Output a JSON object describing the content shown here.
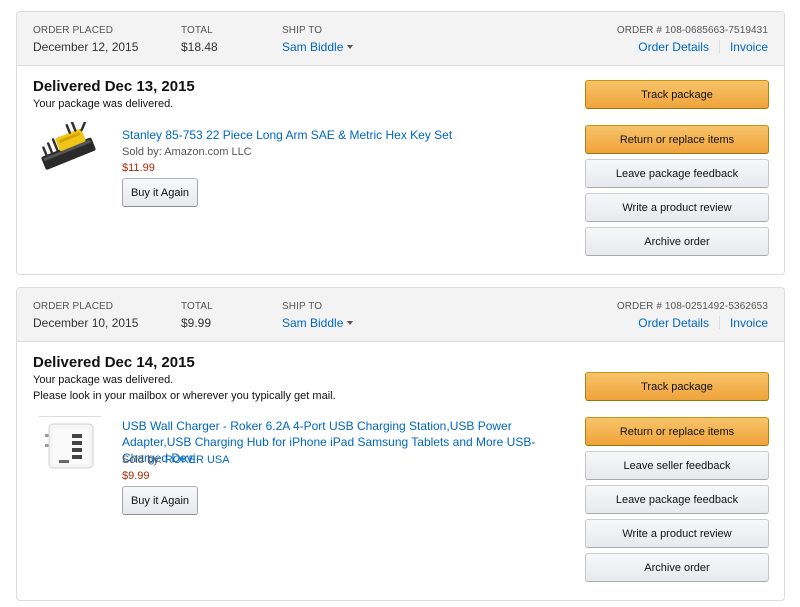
{
  "orders": [
    {
      "placed_label": "ORDER PLACED",
      "placed_date": "December 12, 2015",
      "total_label": "TOTAL",
      "total": "$18.48",
      "ship_label": "SHIP TO",
      "ship_to": "Sam Biddle",
      "order_number": "ORDER # 108-0685663-7519431",
      "details_link": "Order Details",
      "invoice_link": "Invoice",
      "status_title": "Delivered Dec 13, 2015",
      "status_line1": "Your package was delivered.",
      "item_title": "Stanley 85-753 22 Piece Long Arm SAE & Metric Hex Key Set",
      "sold_by_prefix": "Sold by:",
      "seller": "Amazon.com LLC",
      "price": "$11.99",
      "buy_again": "Buy it Again",
      "actions": [
        "Track package",
        "Return or replace items",
        "Leave package feedback",
        "Write a product review",
        "Archive order"
      ]
    },
    {
      "placed_label": "ORDER PLACED",
      "placed_date": "December 10, 2015",
      "total_label": "TOTAL",
      "total": "$9.99",
      "ship_label": "SHIP TO",
      "ship_to": "Sam Biddle",
      "order_number": "ORDER # 108-0251492-5362653",
      "details_link": "Order Details",
      "invoice_link": "Invoice",
      "status_title": "Delivered Dec 14, 2015",
      "status_line1": "Your package was delivered.",
      "status_line2": "Please look in your mailbox or wherever you typically get mail.",
      "item_title": "USB Wall Charger - Roker 6.2A 4-Port USB Charging Station,USB Power Adapter,USB Charging Hub for iPhone iPad Samsung Tablets and More USB-Charged Devi",
      "sold_by_prefix": "Sold by:",
      "seller": "ROKER USA",
      "price": "$9.99",
      "buy_again": "Buy it Again",
      "actions": [
        "Track package",
        "Return or replace items",
        "Leave seller feedback",
        "Leave package feedback",
        "Write a product review",
        "Archive order"
      ]
    }
  ]
}
